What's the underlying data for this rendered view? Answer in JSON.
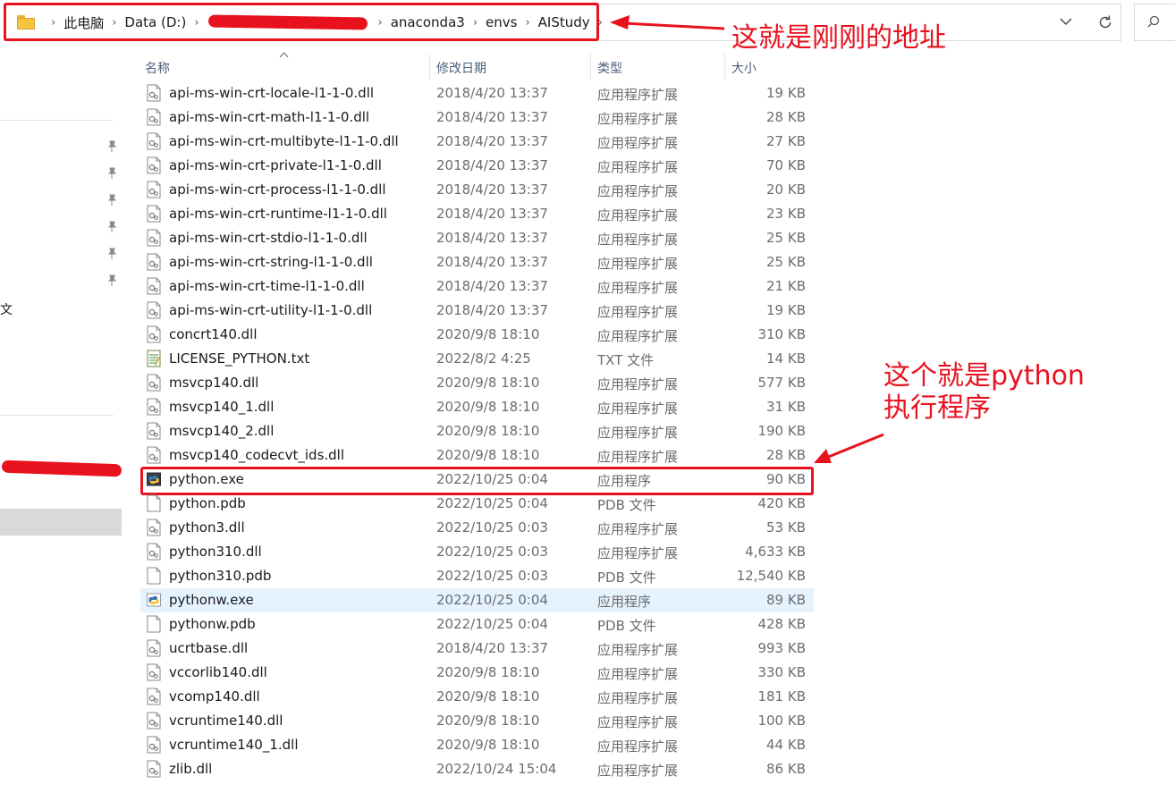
{
  "address_bar": {
    "crumbs": [
      "此电脑",
      "Data (D:)",
      "anaconda3",
      "envs",
      "AIStudy"
    ]
  },
  "columns": {
    "name": "名称",
    "date": "修改日期",
    "type": "类型",
    "size": "大小"
  },
  "nav": {
    "partial_label": "文"
  },
  "annotations": {
    "address": "这就是刚刚的地址",
    "python_line1": "这个就是python",
    "python_line2": "执行程序"
  },
  "colors": {
    "annotation_red": "#e8121f",
    "hover_row": "#e5f3ff",
    "nav_selected": "#d9d9d9"
  },
  "files": [
    {
      "name": "api-ms-win-crt-locale-l1-1-0.dll",
      "date": "2018/4/20 13:37",
      "type": "应用程序扩展",
      "size": "19 KB",
      "icon": "dll-file-icon"
    },
    {
      "name": "api-ms-win-crt-math-l1-1-0.dll",
      "date": "2018/4/20 13:37",
      "type": "应用程序扩展",
      "size": "28 KB",
      "icon": "dll-file-icon"
    },
    {
      "name": "api-ms-win-crt-multibyte-l1-1-0.dll",
      "date": "2018/4/20 13:37",
      "type": "应用程序扩展",
      "size": "27 KB",
      "icon": "dll-file-icon"
    },
    {
      "name": "api-ms-win-crt-private-l1-1-0.dll",
      "date": "2018/4/20 13:37",
      "type": "应用程序扩展",
      "size": "70 KB",
      "icon": "dll-file-icon"
    },
    {
      "name": "api-ms-win-crt-process-l1-1-0.dll",
      "date": "2018/4/20 13:37",
      "type": "应用程序扩展",
      "size": "20 KB",
      "icon": "dll-file-icon"
    },
    {
      "name": "api-ms-win-crt-runtime-l1-1-0.dll",
      "date": "2018/4/20 13:37",
      "type": "应用程序扩展",
      "size": "23 KB",
      "icon": "dll-file-icon"
    },
    {
      "name": "api-ms-win-crt-stdio-l1-1-0.dll",
      "date": "2018/4/20 13:37",
      "type": "应用程序扩展",
      "size": "25 KB",
      "icon": "dll-file-icon"
    },
    {
      "name": "api-ms-win-crt-string-l1-1-0.dll",
      "date": "2018/4/20 13:37",
      "type": "应用程序扩展",
      "size": "25 KB",
      "icon": "dll-file-icon"
    },
    {
      "name": "api-ms-win-crt-time-l1-1-0.dll",
      "date": "2018/4/20 13:37",
      "type": "应用程序扩展",
      "size": "21 KB",
      "icon": "dll-file-icon"
    },
    {
      "name": "api-ms-win-crt-utility-l1-1-0.dll",
      "date": "2018/4/20 13:37",
      "type": "应用程序扩展",
      "size": "19 KB",
      "icon": "dll-file-icon"
    },
    {
      "name": "concrt140.dll",
      "date": "2020/9/8 18:10",
      "type": "应用程序扩展",
      "size": "310 KB",
      "icon": "dll-file-icon"
    },
    {
      "name": "LICENSE_PYTHON.txt",
      "date": "2022/8/2 4:25",
      "type": "TXT 文件",
      "size": "14 KB",
      "icon": "text-file-icon"
    },
    {
      "name": "msvcp140.dll",
      "date": "2020/9/8 18:10",
      "type": "应用程序扩展",
      "size": "577 KB",
      "icon": "dll-file-icon"
    },
    {
      "name": "msvcp140_1.dll",
      "date": "2020/9/8 18:10",
      "type": "应用程序扩展",
      "size": "31 KB",
      "icon": "dll-file-icon"
    },
    {
      "name": "msvcp140_2.dll",
      "date": "2020/9/8 18:10",
      "type": "应用程序扩展",
      "size": "190 KB",
      "icon": "dll-file-icon"
    },
    {
      "name": "msvcp140_codecvt_ids.dll",
      "date": "2020/9/8 18:10",
      "type": "应用程序扩展",
      "size": "28 KB",
      "icon": "dll-file-icon"
    },
    {
      "name": "python.exe",
      "date": "2022/10/25 0:04",
      "type": "应用程序",
      "size": "90 KB",
      "icon": "python-exe-icon"
    },
    {
      "name": "python.pdb",
      "date": "2022/10/25 0:04",
      "type": "PDB 文件",
      "size": "420 KB",
      "icon": "blank-file-icon"
    },
    {
      "name": "python3.dll",
      "date": "2022/10/25 0:03",
      "type": "应用程序扩展",
      "size": "53 KB",
      "icon": "dll-file-icon"
    },
    {
      "name": "python310.dll",
      "date": "2022/10/25 0:03",
      "type": "应用程序扩展",
      "size": "4,633 KB",
      "icon": "dll-file-icon"
    },
    {
      "name": "python310.pdb",
      "date": "2022/10/25 0:03",
      "type": "PDB 文件",
      "size": "12,540 KB",
      "icon": "blank-file-icon"
    },
    {
      "name": "pythonw.exe",
      "date": "2022/10/25 0:04",
      "type": "应用程序",
      "size": "89 KB",
      "icon": "python-window-icon",
      "hover": true
    },
    {
      "name": "pythonw.pdb",
      "date": "2022/10/25 0:04",
      "type": "PDB 文件",
      "size": "428 KB",
      "icon": "blank-file-icon"
    },
    {
      "name": "ucrtbase.dll",
      "date": "2018/4/20 13:37",
      "type": "应用程序扩展",
      "size": "993 KB",
      "icon": "dll-file-icon"
    },
    {
      "name": "vccorlib140.dll",
      "date": "2020/9/8 18:10",
      "type": "应用程序扩展",
      "size": "330 KB",
      "icon": "dll-file-icon"
    },
    {
      "name": "vcomp140.dll",
      "date": "2020/9/8 18:10",
      "type": "应用程序扩展",
      "size": "181 KB",
      "icon": "dll-file-icon"
    },
    {
      "name": "vcruntime140.dll",
      "date": "2020/9/8 18:10",
      "type": "应用程序扩展",
      "size": "100 KB",
      "icon": "dll-file-icon"
    },
    {
      "name": "vcruntime140_1.dll",
      "date": "2020/9/8 18:10",
      "type": "应用程序扩展",
      "size": "44 KB",
      "icon": "dll-file-icon"
    },
    {
      "name": "zlib.dll",
      "date": "2022/10/24 15:04",
      "type": "应用程序扩展",
      "size": "86 KB",
      "icon": "dll-file-icon"
    }
  ]
}
